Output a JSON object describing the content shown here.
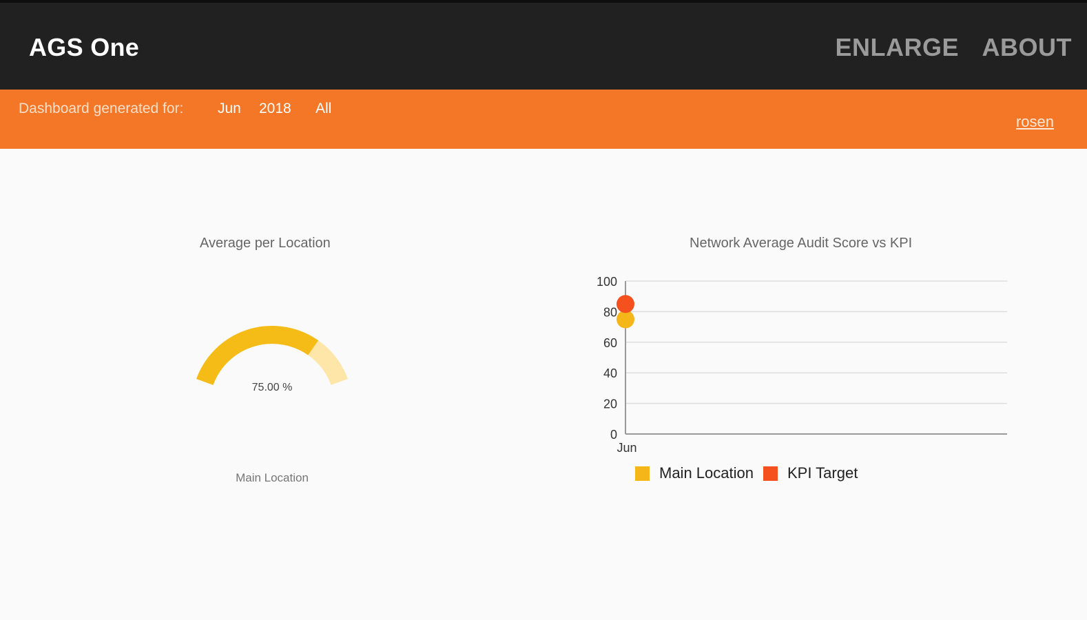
{
  "header": {
    "app_title": "AGS One",
    "nav": [
      {
        "label": "ENLARGE"
      },
      {
        "label": "ABOUT"
      }
    ]
  },
  "filter_bar": {
    "label": "Dashboard generated for:",
    "month": "Jun",
    "year": "2018",
    "scope": "All",
    "user": "rosen"
  },
  "gauge": {
    "title": "Average per Location",
    "value_text": "75.00 %",
    "value_percent": 75,
    "location_label": "Main Location",
    "colors": {
      "fill": "#f5bc17",
      "track": "#fde6a8"
    }
  },
  "chart_data": {
    "type": "scatter",
    "title": "Network Average Audit Score vs KPI",
    "categories": [
      "Jun"
    ],
    "ylim": [
      0,
      100
    ],
    "yticks": [
      0,
      20,
      40,
      60,
      80,
      100
    ],
    "grid": true,
    "legend_position": "bottom",
    "series": [
      {
        "name": "Main Location",
        "values": [
          75
        ],
        "color": "#f5b619"
      },
      {
        "name": "KPI Target",
        "values": [
          85
        ],
        "color": "#f4511e"
      }
    ]
  }
}
